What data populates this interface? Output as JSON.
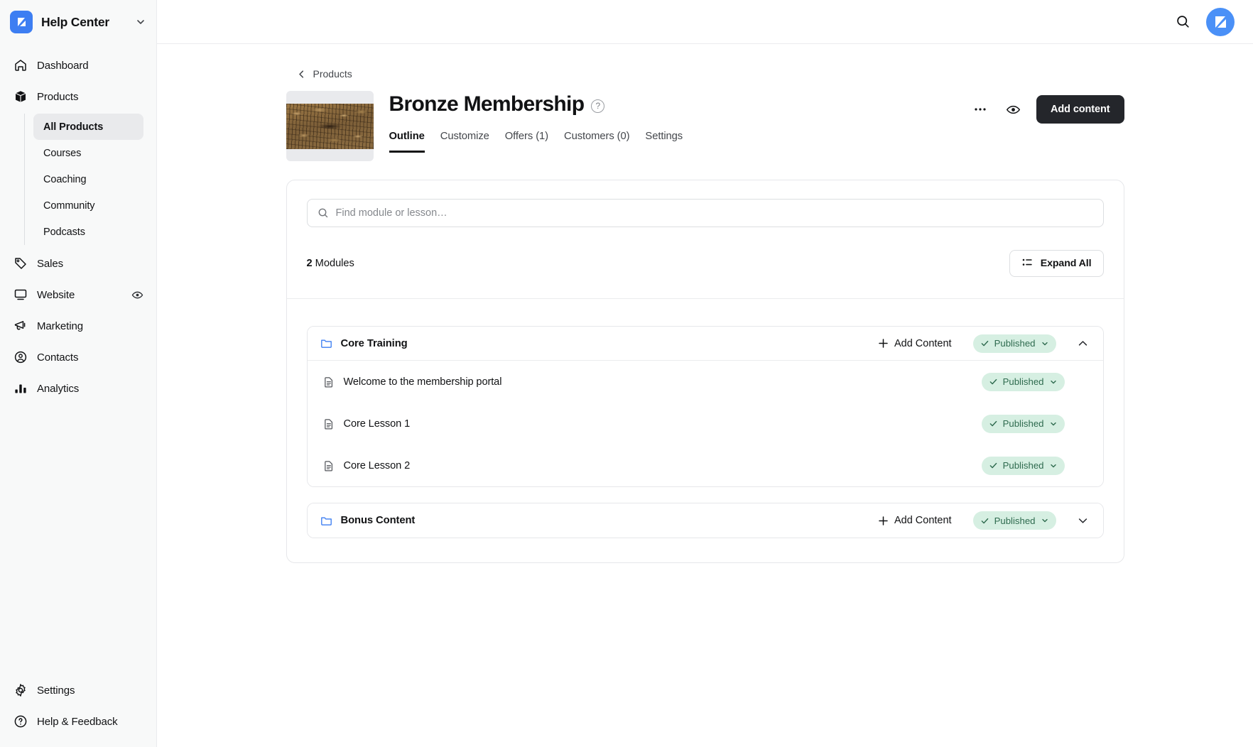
{
  "sidebar": {
    "brand": {
      "name": "Help Center",
      "logo_icon": "kajabi-logo-icon",
      "caret_icon": "chevron-down-icon"
    },
    "items": [
      {
        "label": "Dashboard",
        "icon": "home-icon"
      },
      {
        "label": "Products",
        "icon": "box-icon"
      }
    ],
    "subitems": [
      {
        "label": "All Products",
        "active": true
      },
      {
        "label": "Courses",
        "active": false
      },
      {
        "label": "Coaching",
        "active": false
      },
      {
        "label": "Community",
        "active": false
      },
      {
        "label": "Podcasts",
        "active": false
      }
    ],
    "items2": [
      {
        "label": "Sales",
        "icon": "tag-icon",
        "trailing": ""
      },
      {
        "label": "Website",
        "icon": "monitor-icon",
        "trailing": "eye-icon"
      },
      {
        "label": "Marketing",
        "icon": "megaphone-icon",
        "trailing": ""
      },
      {
        "label": "Contacts",
        "icon": "user-circle-icon",
        "trailing": ""
      },
      {
        "label": "Analytics",
        "icon": "bar-chart-icon",
        "trailing": ""
      }
    ],
    "bottom": [
      {
        "label": "Settings",
        "icon": "gear-icon"
      },
      {
        "label": "Help & Feedback",
        "icon": "question-circle-icon"
      }
    ]
  },
  "topbar": {
    "search_icon": "search-icon",
    "avatar_icon": "kajabi-avatar-icon",
    "avatar_color": "#4a90f7"
  },
  "breadcrumb": {
    "label": "Products",
    "icon": "chevron-left-icon"
  },
  "product": {
    "title": "Bronze Membership",
    "help_icon": "question-mark-icon",
    "thumbnail_alt": "bark-texture-thumbnail"
  },
  "tabs": [
    {
      "label": "Outline",
      "active": true
    },
    {
      "label": "Customize",
      "active": false
    },
    {
      "label": "Offers (1)",
      "active": false
    },
    {
      "label": "Customers (0)",
      "active": false
    },
    {
      "label": "Settings",
      "active": false
    }
  ],
  "header_actions": {
    "more_icon": "ellipsis-icon",
    "preview_icon": "eye-icon",
    "primary_label": "Add content"
  },
  "outline": {
    "search_placeholder": "Find module or lesson…",
    "search_value": "",
    "search_icon": "search-icon",
    "count_number": "2",
    "count_label": " Modules",
    "expand_all_label": "Expand All",
    "expand_all_icon": "list-icon",
    "add_content_label": "Add Content",
    "status_label": "Published",
    "status_bg": "#d6efe2",
    "status_fg": "#2f6b4f",
    "modules": [
      {
        "title": "Core Training",
        "expanded": true,
        "status": "Published",
        "lessons": [
          {
            "title": "Welcome to the membership portal",
            "status": "Published"
          },
          {
            "title": "Core Lesson 1",
            "status": "Published"
          },
          {
            "title": "Core Lesson 2",
            "status": "Published"
          }
        ]
      },
      {
        "title": "Bonus Content",
        "expanded": false,
        "status": "Published",
        "lessons": []
      }
    ]
  }
}
